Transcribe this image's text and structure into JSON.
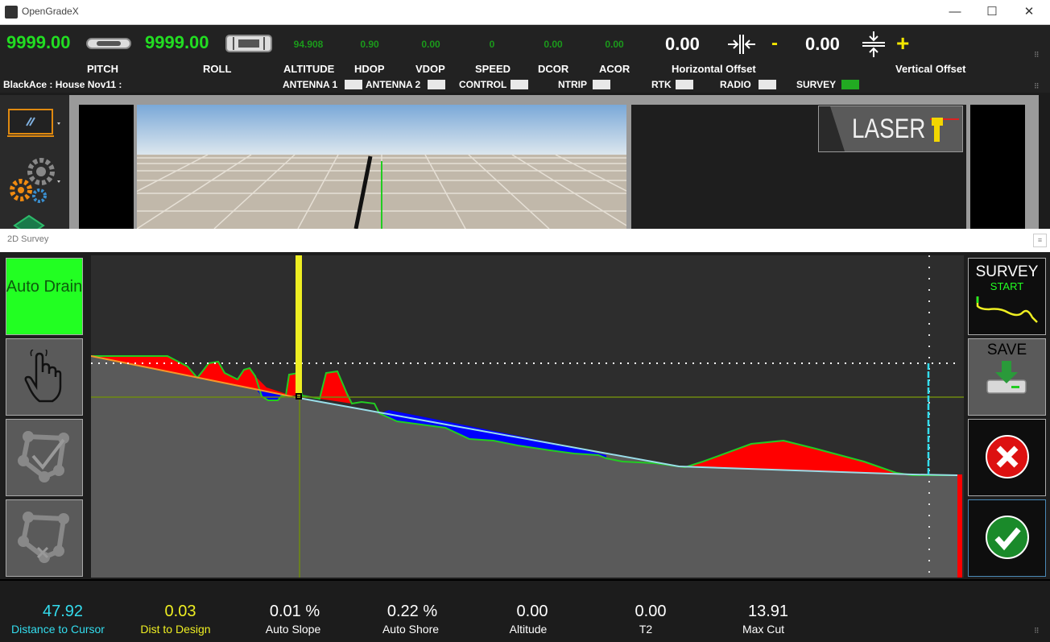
{
  "window": {
    "title": "OpenGradeX",
    "minimize": "—",
    "maximize": "☐",
    "close": "✕"
  },
  "top": {
    "pitch_value": "9999.00",
    "roll_value": "9999.00",
    "altitude_value": "94.908",
    "hdop_value": "0.90",
    "vdop_value": "0.00",
    "speed_value": "0",
    "dcor_value": "0.00",
    "acor_value": "0.00",
    "horizontal_offset_value": "0.00",
    "vertical_offset_value": "0.00",
    "minus_label": "-",
    "plus_label": "+",
    "labels": {
      "pitch": "PITCH",
      "roll": "ROLL",
      "altitude": "ALTITUDE",
      "hdop": "HDOP",
      "vdop": "VDOP",
      "speed": "SPEED",
      "dcor": "DCOR",
      "acor": "ACOR",
      "horizontal_offset": "Horizontal Offset",
      "vertical_offset": "Vertical Offset"
    }
  },
  "status": {
    "job": "BlackAce : House Nov11 :",
    "antenna1": "ANTENNA 1",
    "antenna2": "ANTENNA 2",
    "control": "CONTROL",
    "ntrip": "NTRIP",
    "rtk": "RTK",
    "radio": "RADIO",
    "survey": "SURVEY",
    "colors": {
      "inactive": "#e8e8e8",
      "survey_active": "#22aa22"
    }
  },
  "laser_panel": {
    "label": "LASER"
  },
  "survey_window": {
    "title": "2D Survey",
    "auto_drain_label": "Auto Drain",
    "survey_button_label": "SURVEY",
    "survey_button_sub": "START",
    "save_button_label": "SAVE"
  },
  "bottom": {
    "distance_to_cursor_value": "47.92",
    "distance_to_cursor_label": "Distance to Cursor",
    "dist_to_design_value": "0.03",
    "dist_to_design_label": "Dist to Design",
    "auto_slope_value": "0.01 %",
    "auto_slope_label": "Auto Slope",
    "auto_shore_value": "0.22 %",
    "auto_shore_label": "Auto Shore",
    "altitude_value": "0.00",
    "altitude_label": "Altitude",
    "t2_value": "0.00",
    "t2_label": "T2",
    "max_cut_value": "13.91",
    "max_cut_label": "Max Cut"
  },
  "colors": {
    "accent_green": "#22ff22",
    "cursor_cyan": "#33ddee",
    "design_yellow": "#eeee22",
    "cut_red": "#ff0000",
    "fill_blue": "#0000ff"
  }
}
